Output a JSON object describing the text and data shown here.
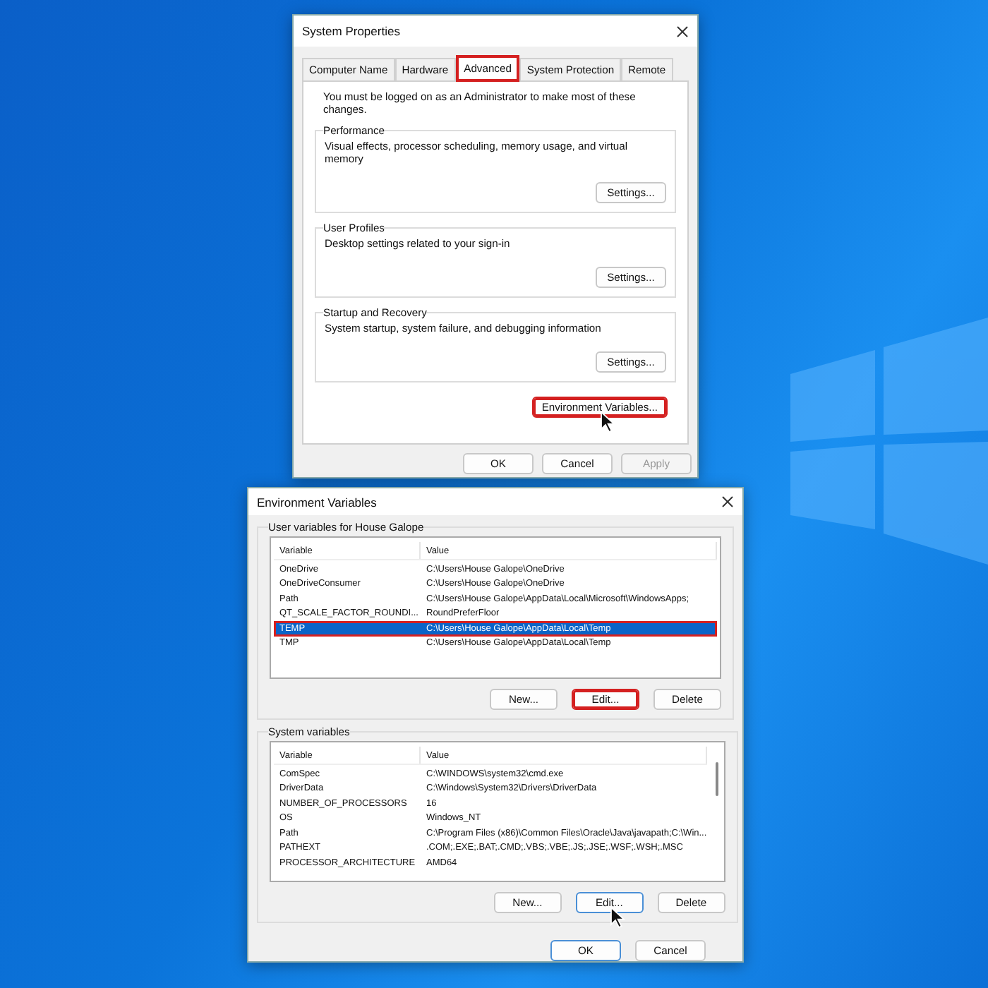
{
  "system_properties": {
    "title": "System Properties",
    "tabs": [
      {
        "label": "Computer Name",
        "selected": false,
        "highlighted": false
      },
      {
        "label": "Hardware",
        "selected": false,
        "highlighted": false
      },
      {
        "label": "Advanced",
        "selected": true,
        "highlighted": true
      },
      {
        "label": "System Protection",
        "selected": false,
        "highlighted": false
      },
      {
        "label": "Remote",
        "selected": false,
        "highlighted": false
      }
    ],
    "notice": "You must be logged on as an Administrator to make most of these changes.",
    "groups": [
      {
        "title": "Performance",
        "description": "Visual effects, processor scheduling, memory usage, and virtual memory",
        "button": "Settings..."
      },
      {
        "title": "User Profiles",
        "description": "Desktop settings related to your sign-in",
        "button": "Settings..."
      },
      {
        "title": "Startup and Recovery",
        "description": "System startup, system failure, and debugging information",
        "button": "Settings..."
      }
    ],
    "env_button": {
      "label": "Environment Variables...",
      "highlighted": true,
      "pointer": true
    },
    "buttons": [
      {
        "label": "OK",
        "disabled": false
      },
      {
        "label": "Cancel",
        "disabled": false
      },
      {
        "label": "Apply",
        "disabled": true
      }
    ]
  },
  "environment_variables": {
    "title": "Environment Variables",
    "sections": [
      {
        "title": "User variables for House Galope",
        "columns": [
          "Variable",
          "Value"
        ],
        "scrollbar": false,
        "rows": [
          {
            "variable": "OneDrive",
            "value": "C:\\Users\\House Galope\\OneDrive",
            "selected": false,
            "highlighted": false
          },
          {
            "variable": "OneDriveConsumer",
            "value": "C:\\Users\\House Galope\\OneDrive",
            "selected": false,
            "highlighted": false
          },
          {
            "variable": "Path",
            "value": "C:\\Users\\House Galope\\AppData\\Local\\Microsoft\\WindowsApps;",
            "selected": false,
            "highlighted": false
          },
          {
            "variable": "QT_SCALE_FACTOR_ROUNDI...",
            "value": "RoundPreferFloor",
            "selected": false,
            "highlighted": false
          },
          {
            "variable": "TEMP",
            "value": "C:\\Users\\House Galope\\AppData\\Local\\Temp",
            "selected": true,
            "highlighted": true
          },
          {
            "variable": "TMP",
            "value": "C:\\Users\\House Galope\\AppData\\Local\\Temp",
            "selected": false,
            "highlighted": false
          }
        ],
        "buttons": [
          {
            "label": "New...",
            "highlighted": false,
            "pointer": false
          },
          {
            "label": "Edit...",
            "highlighted": true,
            "pointer": false
          },
          {
            "label": "Delete",
            "highlighted": false,
            "pointer": false
          }
        ]
      },
      {
        "title": "System variables",
        "columns": [
          "Variable",
          "Value"
        ],
        "scrollbar": true,
        "rows": [
          {
            "variable": "ComSpec",
            "value": "C:\\WINDOWS\\system32\\cmd.exe",
            "selected": false,
            "highlighted": false
          },
          {
            "variable": "DriverData",
            "value": "C:\\Windows\\System32\\Drivers\\DriverData",
            "selected": false,
            "highlighted": false
          },
          {
            "variable": "NUMBER_OF_PROCESSORS",
            "value": "16",
            "selected": false,
            "highlighted": false
          },
          {
            "variable": "OS",
            "value": "Windows_NT",
            "selected": false,
            "highlighted": false
          },
          {
            "variable": "Path",
            "value": "C:\\Program Files (x86)\\Common Files\\Oracle\\Java\\javapath;C:\\Win...",
            "selected": false,
            "highlighted": false
          },
          {
            "variable": "PATHEXT",
            "value": ".COM;.EXE;.BAT;.CMD;.VBS;.VBE;.JS;.JSE;.WSF;.WSH;.MSC",
            "selected": false,
            "highlighted": false
          },
          {
            "variable": "PROCESSOR_ARCHITECTURE",
            "value": "AMD64",
            "selected": false,
            "highlighted": false
          }
        ],
        "buttons": [
          {
            "label": "New...",
            "highlighted": false,
            "pointer": false
          },
          {
            "label": "Edit...",
            "highlighted": false,
            "pointer": true
          },
          {
            "label": "Delete",
            "highlighted": false,
            "pointer": false
          }
        ]
      }
    ],
    "buttons": [
      {
        "label": "OK",
        "disabled": false
      },
      {
        "label": "Cancel",
        "disabled": false
      }
    ]
  }
}
